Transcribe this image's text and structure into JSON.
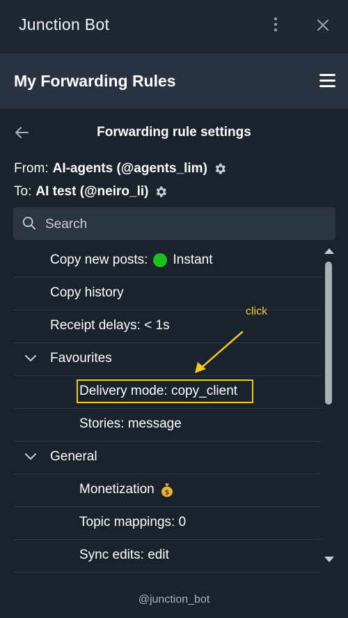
{
  "app": {
    "title": "Junction Bot"
  },
  "header": {
    "title": "My Forwarding Rules"
  },
  "settings": {
    "title": "Forwarding rule settings",
    "from_label": "From:",
    "from_value": "AI-agents (@agents_lim)",
    "to_label": "To:",
    "to_value": "AI test (@neiro_li)"
  },
  "search": {
    "placeholder": "Search"
  },
  "items": [
    {
      "label": "Copy new posts:",
      "status_text": "Instant",
      "status_color": "#1dbf1d"
    },
    {
      "label": "Copy history"
    },
    {
      "label": "Receipt delays: < 1s"
    },
    {
      "label": "Favourites",
      "expanded": true
    },
    {
      "label": "Delivery mode: copy_client",
      "highlighted": true
    },
    {
      "label": "Stories: message"
    },
    {
      "label": "General",
      "expanded": true
    },
    {
      "label": "Monetization",
      "icon": "money-bag-icon"
    },
    {
      "label": "Topic mappings: 0"
    },
    {
      "label": "Sync edits: edit"
    }
  ],
  "annotation": {
    "text": "click",
    "color": "#f4c91e"
  },
  "footer": {
    "text": "@junction_bot"
  },
  "colors": {
    "background": "#1a222d",
    "header": "#283240",
    "accent": "#f4c91e"
  }
}
